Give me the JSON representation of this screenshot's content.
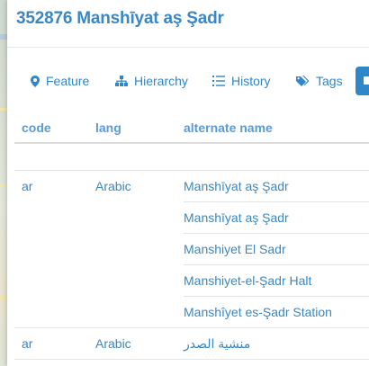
{
  "title": "352876 Manshīyat aş Şadr",
  "tabs": [
    {
      "label": "Feature",
      "icon": "map-marker-icon"
    },
    {
      "label": "Hierarchy",
      "icon": "sitemap-icon"
    },
    {
      "label": "History",
      "icon": "list-icon"
    },
    {
      "label": "Tags",
      "icon": "tags-icon"
    }
  ],
  "table": {
    "headers": {
      "code": "code",
      "lang": "lang",
      "name": "alternate name"
    },
    "rows": [
      {
        "code": "",
        "lang": "",
        "name": ""
      },
      {
        "code": "ar",
        "lang": "Arabic",
        "name": "Manshīyat aş Şadr"
      },
      {
        "code": "",
        "lang": "",
        "name": "Manshīyat aş Şadr"
      },
      {
        "code": "",
        "lang": "",
        "name": "Manshiyet El Sadr"
      },
      {
        "code": "",
        "lang": "",
        "name": "Manshiyet-el-Şadr Halt"
      },
      {
        "code": "",
        "lang": "",
        "name": "Manshîyet es-Şadr Station"
      },
      {
        "code": "ar",
        "lang": "Arabic",
        "name": "منشية الصدر"
      }
    ]
  },
  "colors": {
    "accent": "#2f86c9",
    "title": "#3a87c4",
    "header": "#5b9bd5"
  }
}
